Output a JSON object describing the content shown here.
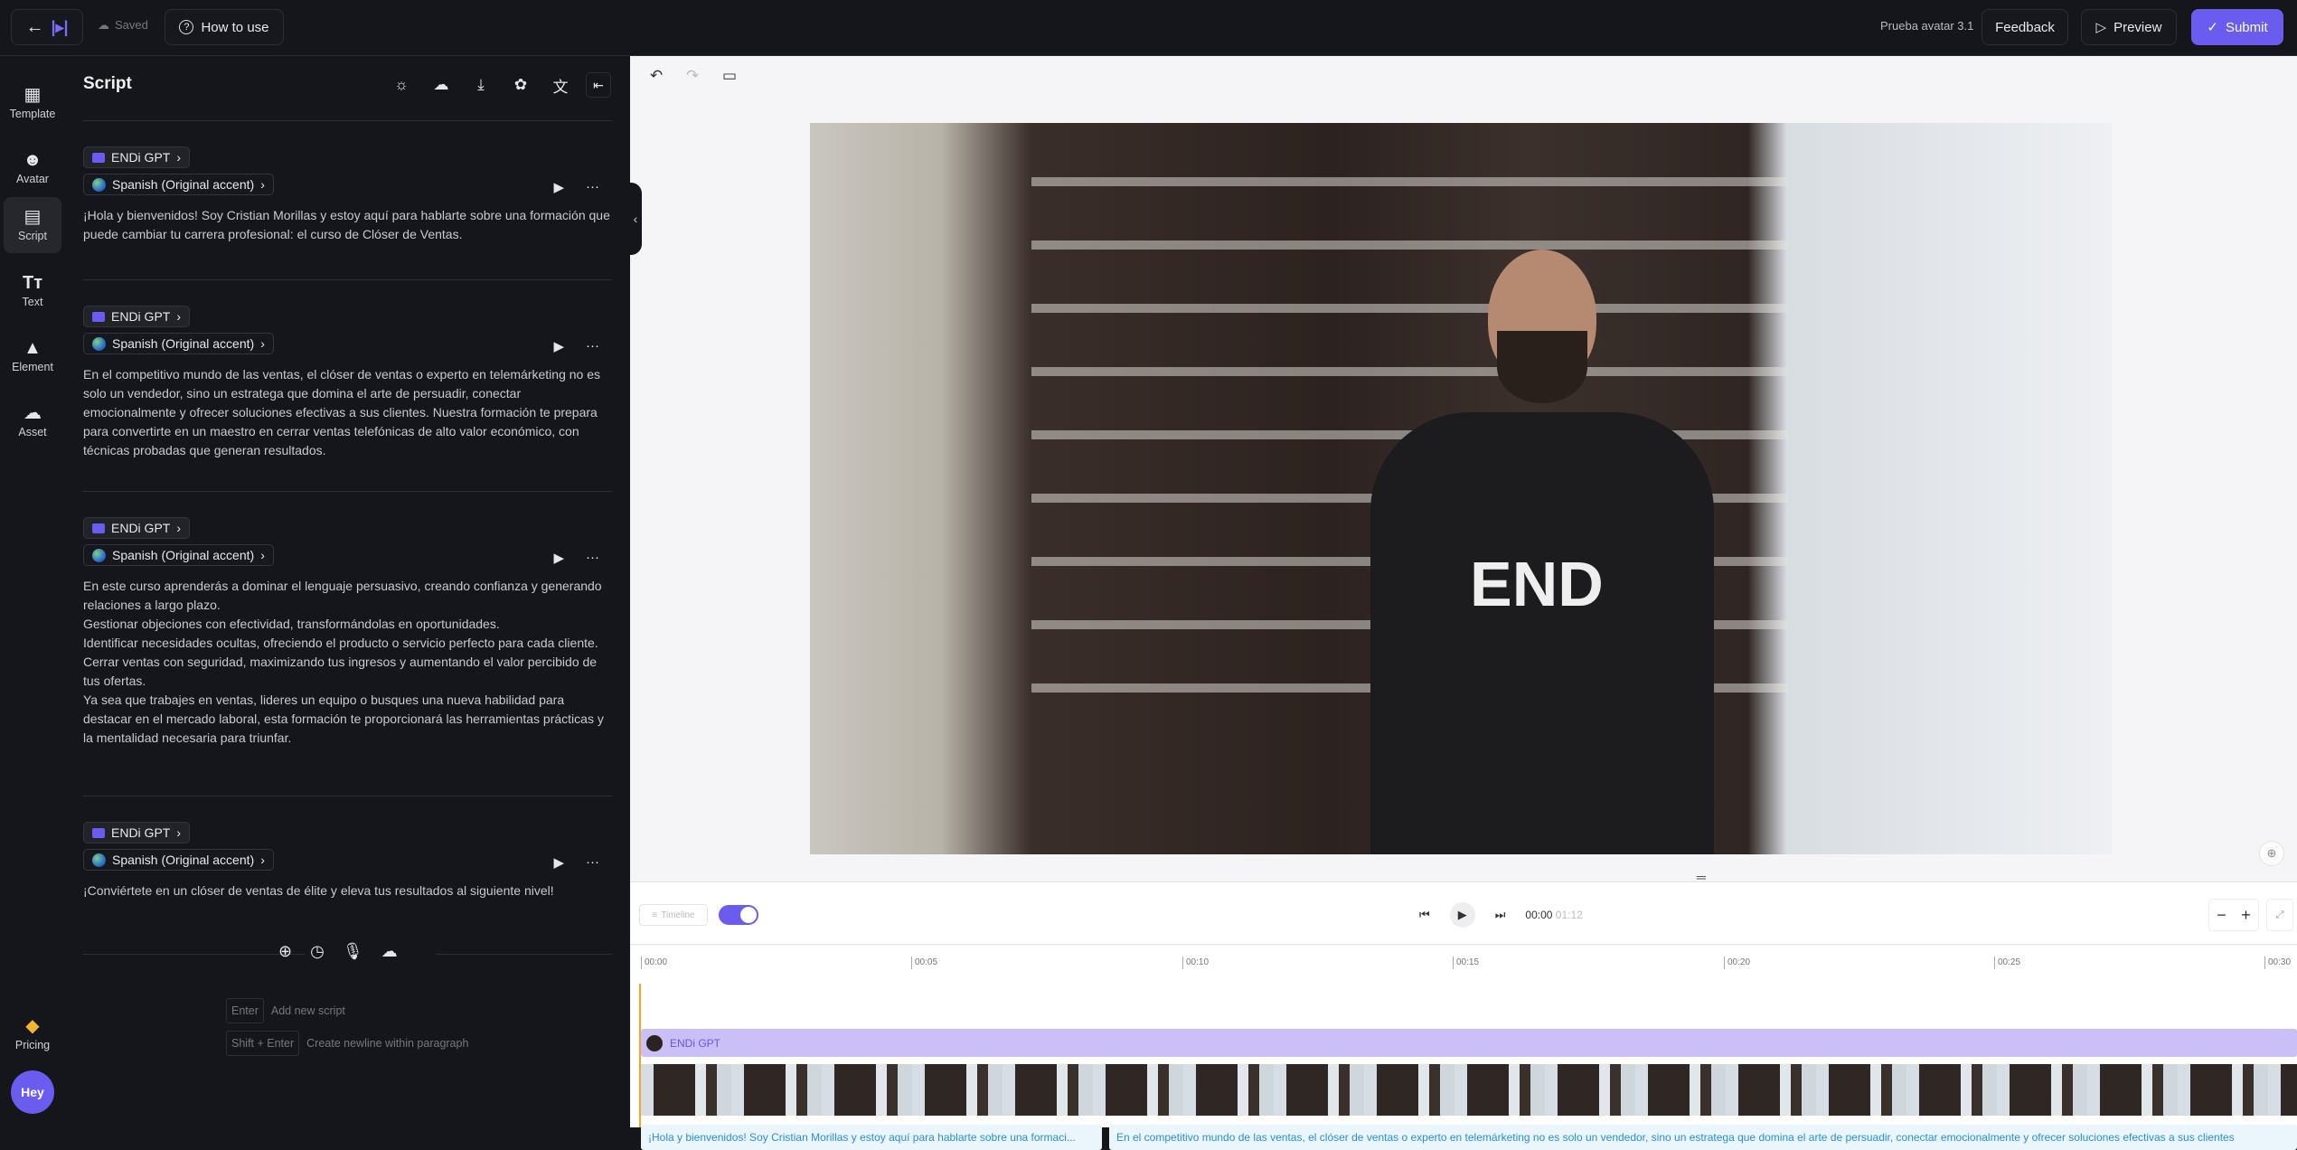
{
  "topbar": {
    "saved": "Saved",
    "how_to_use": "How to use",
    "project_name": "Prueba avatar 3.1",
    "feedback": "Feedback",
    "preview": "Preview",
    "submit": "Submit",
    "accent": "#6b5cf0"
  },
  "rail": [
    {
      "label": "Template",
      "icon": "template-icon"
    },
    {
      "label": "Avatar",
      "icon": "avatar-icon"
    },
    {
      "label": "Script",
      "icon": "script-icon"
    },
    {
      "label": "Text",
      "icon": "text-icon"
    },
    {
      "label": "Element",
      "icon": "element-icon"
    },
    {
      "label": "Asset",
      "icon": "asset-icon"
    }
  ],
  "rail_bottom": {
    "pricing": "Pricing",
    "hey": "Hey"
  },
  "script": {
    "title": "Script",
    "blocks": [
      {
        "voice": "ENDi GPT",
        "language": "Spanish (Original accent)",
        "text": "¡Hola y bienvenidos! Soy Cristian Morillas y estoy aquí para hablarte sobre una formación que puede cambiar tu carrera profesional: el curso de Clóser de Ventas."
      },
      {
        "voice": "ENDi GPT",
        "language": "Spanish (Original accent)",
        "text": "En el competitivo mundo de las ventas, el clóser de ventas o experto en telemárketing no es solo un vendedor, sino un estratega que domina el arte de persuadir, conectar emocionalmente y ofrecer soluciones efectivas a sus clientes. Nuestra formación te prepara para convertirte en un maestro en cerrar ventas telefónicas de alto valor económico, con técnicas probadas que generan resultados."
      },
      {
        "voice": "ENDi GPT",
        "language": "Spanish (Original accent)",
        "text": "En este curso aprenderás a dominar el lenguaje persuasivo, creando confianza y generando relaciones a largo plazo.\nGestionar objeciones con efectividad, transformándolas en oportunidades.\nIdentificar necesidades ocultas, ofreciendo el producto o servicio perfecto para cada cliente.\nCerrar ventas con seguridad, maximizando tus ingresos y aumentando el valor percibido de tus ofertas.\nYa sea que trabajes en ventas, lideres un equipo o busques una nueva habilidad para destacar en el mercado laboral, esta formación te proporcionará las herramientas prácticas y la mentalidad necesaria para triunfar."
      },
      {
        "voice": "ENDi GPT",
        "language": "Spanish (Original accent)",
        "text": "¡Conviértete en un clóser de ventas de élite y eleva tus resultados al siguiente nivel!"
      }
    ],
    "hints": [
      {
        "key": "Enter",
        "desc": "Add new script"
      },
      {
        "key": "Shift + Enter",
        "desc": "Create newline within paragraph"
      }
    ]
  },
  "video": {
    "shirt_text": "END"
  },
  "timeline": {
    "toggle_label": "Timeline",
    "current": "00:00",
    "total": "01:12",
    "ticks": [
      "00:00",
      "00:05",
      "00:10",
      "00:15",
      "00:20",
      "00:25",
      "00:30"
    ],
    "track_label": "ENDi GPT",
    "captions": [
      "¡Hola y bienvenidos! Soy Cristian Morillas y estoy aquí para hablarte sobre una formaci...",
      "En el competitivo mundo de las ventas, el clóser de ventas o experto en telemárketing no es solo un vendedor, sino un estratega que domina el arte de persuadir, conectar emocionalmente y ofrecer soluciones efectivas a sus clientes"
    ]
  }
}
